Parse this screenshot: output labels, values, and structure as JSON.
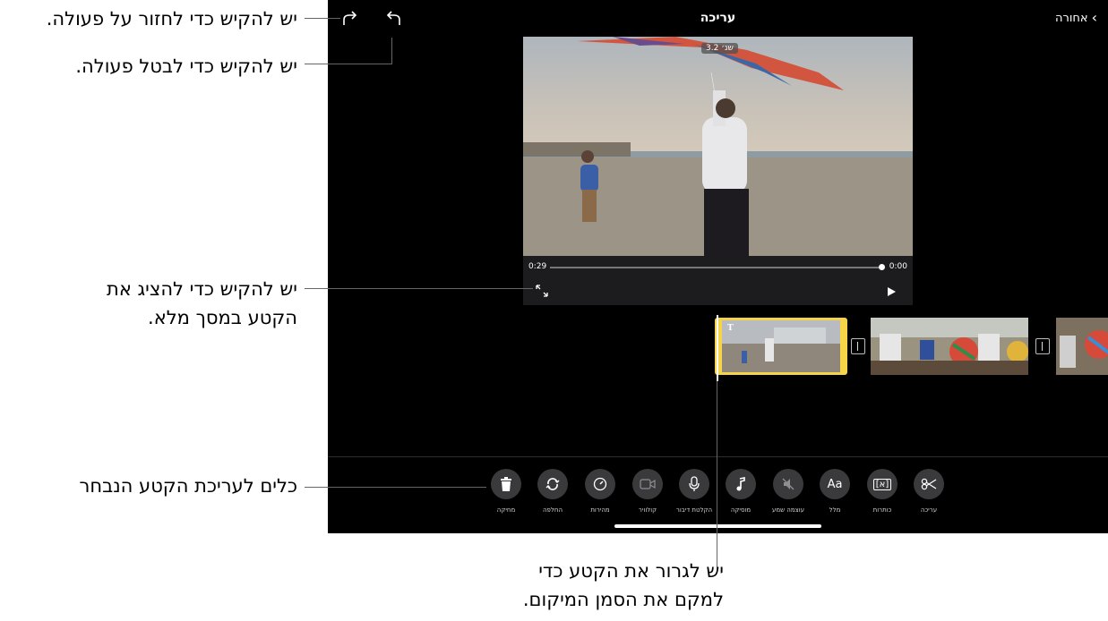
{
  "header": {
    "back_label": "אחורה",
    "title": "עריכה"
  },
  "viewer": {
    "duration_badge": "3.2 שנ׳",
    "time_elapsed": "0:00",
    "time_remaining": "0:29"
  },
  "tools": {
    "delete": "מחיקה",
    "replace": "החלפה",
    "speed": "מהירות",
    "cutaway": "קולוויר",
    "voiceover": "הקלטת דיבור",
    "music": "מוסיקה",
    "audio": "עוצמה שמע",
    "text_icon": "Aa",
    "text": "מלל",
    "titles_icon": "[א]",
    "titles": "כותרות",
    "edit": "עריכה"
  },
  "timeline": {
    "title_marker": "T"
  },
  "callouts": {
    "redo": "יש להקיש כדי לחזור על פעולה.",
    "undo": "יש להקיש כדי לבטל פעולה.",
    "fullscreen_line1": "יש להקיש כדי להציג את",
    "fullscreen_line2": "הקטע במסך מלא.",
    "tools": "כלים לעריכת הקטע הנבחר",
    "drag_line1": "יש לגרור את הקטע כדי",
    "drag_line2": "למקם את הסמן המיקום."
  },
  "icons": {
    "back": "chevron-left-icon",
    "redo": "redo-arrow-icon",
    "undo": "undo-arrow-icon",
    "fullscreen": "expand-arrows-icon",
    "play": "play-icon",
    "delete": "trash-icon",
    "replace": "replace-cycle-icon",
    "speed": "speedometer-icon",
    "cutaway": "video-camera-icon",
    "voiceover": "microphone-icon",
    "music": "music-note-icon",
    "audio": "speaker-mute-icon",
    "titles": "title-box-icon",
    "edit": "scissors-icon"
  },
  "colors": {
    "background": "#000000",
    "selection": "#f5d547",
    "tool_circle": "#3a3a3c"
  }
}
